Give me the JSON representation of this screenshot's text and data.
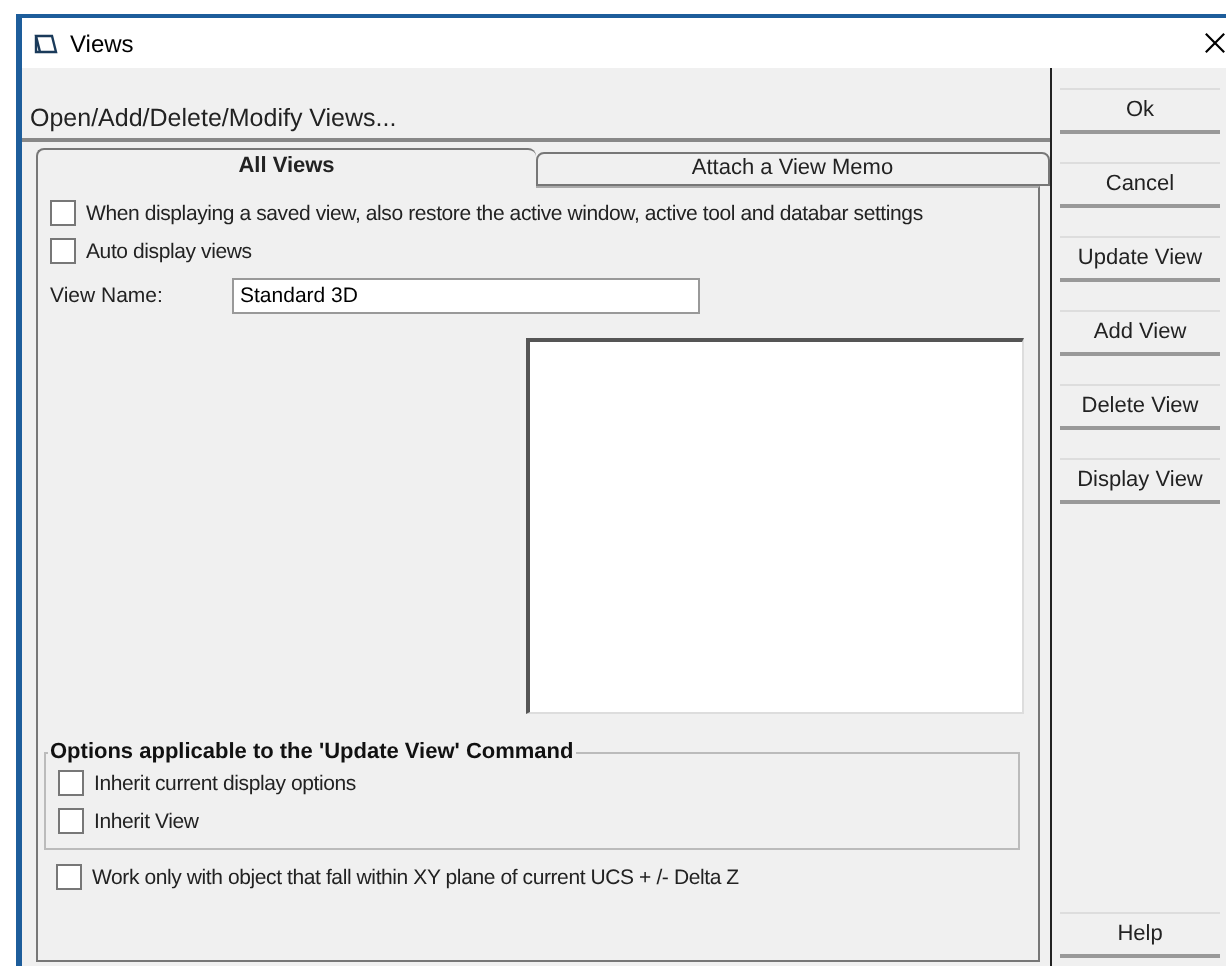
{
  "window": {
    "title": "Views"
  },
  "header": "Open/Add/Delete/Modify Views...",
  "tabs": [
    {
      "label": "All Views",
      "selected": true
    },
    {
      "label": "Attach a View Memo",
      "selected": false
    }
  ],
  "options": [
    {
      "label": "When displaying a saved view, also restore the active window, active tool and databar settings",
      "checked": false
    },
    {
      "label": "Auto display views",
      "checked": false
    }
  ],
  "view_name": {
    "label": "View Name:",
    "value": "Standard 3D"
  },
  "update_group": {
    "title": "Options applicable to the 'Update View' Command",
    "options": [
      {
        "label": "Inherit current display options",
        "checked": false
      },
      {
        "label": "Inherit View",
        "checked": false
      }
    ]
  },
  "bottom_option": {
    "label": "Work only with object that fall within XY plane of current UCS + /- Delta Z",
    "checked": false
  },
  "buttons": [
    "Ok",
    "Cancel",
    "Update View",
    "Add View",
    "Delete View",
    "Display View"
  ],
  "help_button": "Help"
}
